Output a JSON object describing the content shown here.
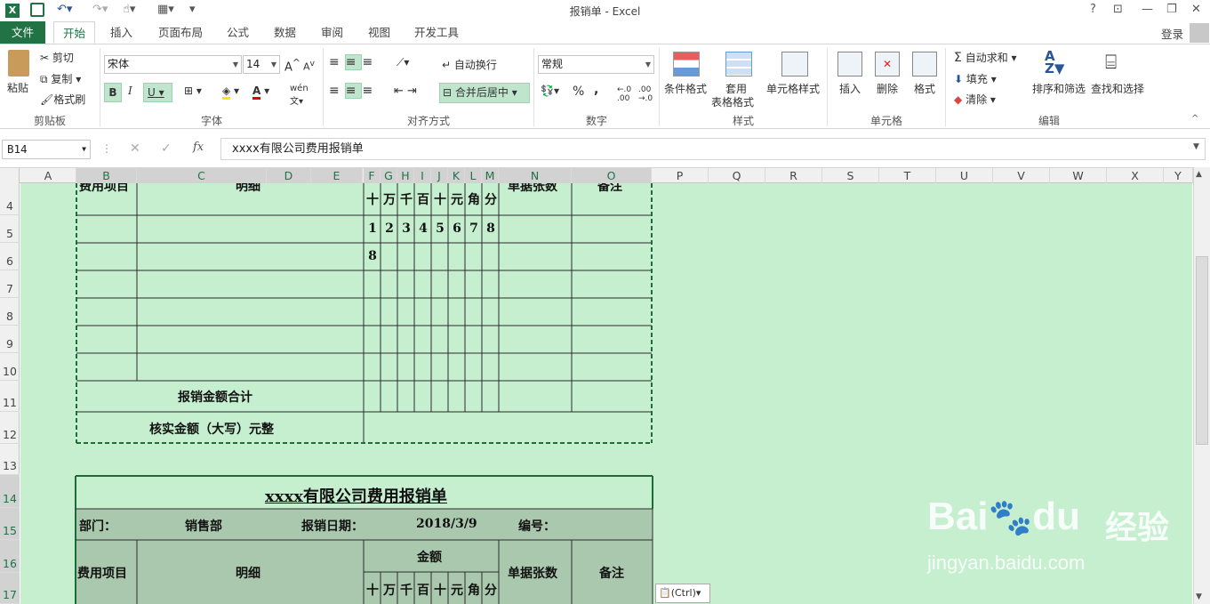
{
  "window": {
    "title": "报销单 - Excel",
    "help": "?",
    "user": "登录"
  },
  "tabs": [
    "文件",
    "开始",
    "插入",
    "页面布局",
    "公式",
    "数据",
    "审阅",
    "视图",
    "开发工具"
  ],
  "ribbon": {
    "clipboard": {
      "paste": "粘贴",
      "cut": "剪切",
      "copy": "复制",
      "format_painter": "格式刷",
      "label": "剪贴板"
    },
    "font": {
      "name": "宋体",
      "size": "14",
      "bold": "B",
      "italic": "I",
      "underline": "U",
      "label": "字体",
      "pinyin": "wén"
    },
    "alignment": {
      "wrap": "自动换行",
      "merge": "合并后居中",
      "label": "对齐方式"
    },
    "number": {
      "format": "常规",
      "percent": "%",
      "comma": ",",
      "label": "数字"
    },
    "styles": {
      "conditional": "条件格式",
      "table_line1": "套用",
      "table_line2": "表格格式",
      "cell_styles": "单元格样式",
      "label": "样式"
    },
    "cells": {
      "insert": "插入",
      "delete": "删除",
      "format": "格式",
      "label": "单元格"
    },
    "editing": {
      "autosum": "自动求和",
      "fill": "填充",
      "clear": "清除",
      "sort": "排序和筛选",
      "find": "查找和选择",
      "label": "编辑"
    }
  },
  "formula_bar": {
    "name_box": "B14",
    "fx": "fx",
    "content": "xxxx有限公司费用报销单"
  },
  "columns": [
    "A",
    "B",
    "C",
    "D",
    "E",
    "F",
    "G",
    "H",
    "I",
    "J",
    "K",
    "L",
    "M",
    "N",
    "O",
    "P",
    "Q",
    "R",
    "S",
    "T",
    "U",
    "V",
    "W",
    "X",
    "Y"
  ],
  "rows": [
    "4",
    "5",
    "6",
    "7",
    "8",
    "9",
    "10",
    "11",
    "12",
    "13",
    "14",
    "15",
    "16",
    "17"
  ],
  "top_table": {
    "partial_header": {
      "col_b": "费用项目",
      "col_c": "明细",
      "col_n": "单据张数",
      "col_o": "备注"
    },
    "units": [
      "十",
      "万",
      "千",
      "百",
      "十",
      "元",
      "角",
      "分"
    ],
    "row5_digits": [
      "1",
      "2",
      "3",
      "4",
      "5",
      "6",
      "7",
      "8"
    ],
    "row6_digits": [
      "8"
    ],
    "total_label": "报销金额合计",
    "verified_label": "核实金额（大写）元整"
  },
  "bottom_table": {
    "title": "xxxx有限公司费用报销单",
    "dept_label": "部门：",
    "dept_value": "销售部",
    "date_label": "报销日期：",
    "date_value": "2018/3/9",
    "number_label": "编号：",
    "col_item": "费用项目",
    "col_detail": "明细",
    "col_amount": "金额",
    "col_receipts": "单据张数",
    "col_remark": "备注",
    "units": [
      "十",
      "万",
      "千",
      "百",
      "十",
      "元",
      "角",
      "分"
    ]
  },
  "paste_options": "(Ctrl)",
  "watermark": {
    "brand": "Bai",
    "brand2": "du",
    "cn": "经验",
    "url": "jingyan.baidu.com"
  },
  "colors": {
    "excel_green": "#217346",
    "sheet_bg": "#c6efd0",
    "header_band": "#a9c8ad"
  }
}
